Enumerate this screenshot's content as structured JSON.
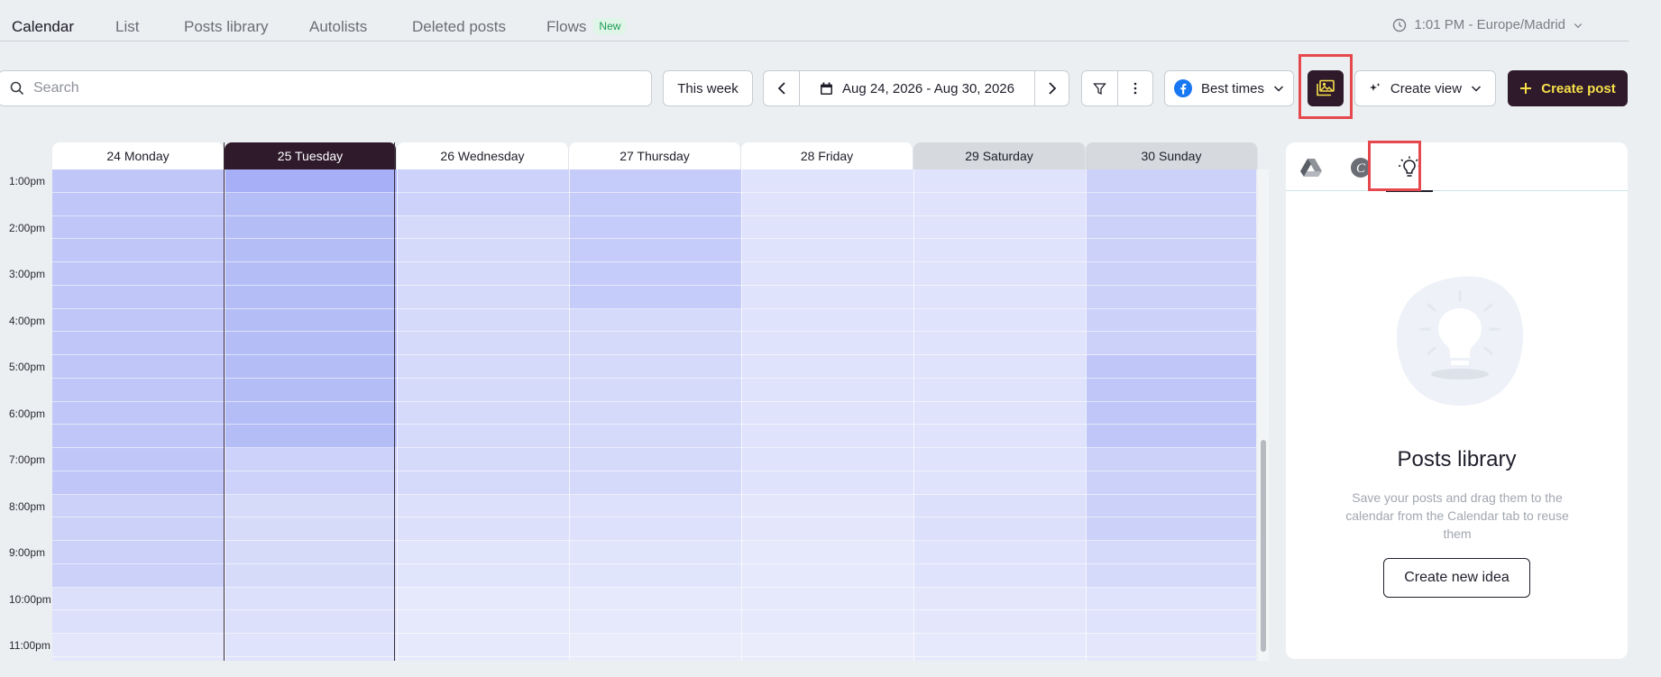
{
  "tabs": [
    {
      "label": "Calendar",
      "active": true
    },
    {
      "label": "List"
    },
    {
      "label": "Posts library"
    },
    {
      "label": "Autolists"
    },
    {
      "label": "Deleted posts"
    },
    {
      "label": "Flows",
      "badge": "New"
    }
  ],
  "timezone": {
    "label": "1:01 PM - Europe/Madrid",
    "icon": "clock-icon"
  },
  "toolbar": {
    "search_placeholder": "Search",
    "this_week": "This week",
    "date_range": "Aug 24, 2026 - Aug 30, 2026",
    "best_times": "Best times",
    "create_view": "Create view",
    "create_post": "Create post"
  },
  "calendar": {
    "days": [
      {
        "label": "24 Monday"
      },
      {
        "label": "25 Tuesday",
        "today": true
      },
      {
        "label": "26 Wednesday"
      },
      {
        "label": "27 Thursday"
      },
      {
        "label": "28 Friday"
      },
      {
        "label": "29 Saturday",
        "weekend": true
      },
      {
        "label": "30 Sunday",
        "weekend": true
      }
    ],
    "hours": [
      "1:00pm",
      "2:00pm",
      "3:00pm",
      "4:00pm",
      "5:00pm",
      "6:00pm",
      "7:00pm",
      "8:00pm",
      "9:00pm",
      "10:00pm",
      "11:00pm"
    ],
    "best_time_intensity": [
      [
        0.55,
        0.55,
        0.55,
        0.55,
        0.55,
        0.55,
        0.55,
        0.55,
        0.55,
        0.55,
        0.55,
        0.55,
        0.55,
        0.55,
        0.42,
        0.42,
        0.42,
        0.42,
        0.22,
        0.22,
        0.12,
        0.12
      ],
      [
        0.85,
        0.68,
        0.68,
        0.68,
        0.68,
        0.68,
        0.68,
        0.68,
        0.68,
        0.68,
        0.68,
        0.68,
        0.4,
        0.4,
        0.28,
        0.28,
        0.28,
        0.28,
        0.22,
        0.22,
        0.18,
        0.18
      ],
      [
        0.4,
        0.4,
        0.3,
        0.3,
        0.3,
        0.3,
        0.3,
        0.3,
        0.3,
        0.3,
        0.3,
        0.3,
        0.3,
        0.3,
        0.22,
        0.22,
        0.15,
        0.15,
        0.1,
        0.1,
        0.1,
        0.1
      ],
      [
        0.48,
        0.48,
        0.48,
        0.48,
        0.48,
        0.48,
        0.3,
        0.3,
        0.3,
        0.3,
        0.3,
        0.3,
        0.3,
        0.3,
        0.2,
        0.2,
        0.15,
        0.15,
        0.1,
        0.1,
        0.05,
        0.05
      ],
      [
        0.18,
        0.18,
        0.18,
        0.18,
        0.18,
        0.18,
        0.18,
        0.18,
        0.18,
        0.18,
        0.18,
        0.18,
        0.18,
        0.18,
        0.12,
        0.12,
        0.1,
        0.1,
        0.1,
        0.1,
        0.05,
        0.05
      ],
      [
        0.18,
        0.18,
        0.18,
        0.18,
        0.18,
        0.18,
        0.18,
        0.18,
        0.18,
        0.18,
        0.18,
        0.18,
        0.18,
        0.18,
        0.22,
        0.22,
        0.18,
        0.18,
        0.12,
        0.12,
        0.1,
        0.1
      ],
      [
        0.42,
        0.42,
        0.42,
        0.42,
        0.42,
        0.42,
        0.42,
        0.42,
        0.55,
        0.55,
        0.55,
        0.55,
        0.42,
        0.42,
        0.42,
        0.42,
        0.3,
        0.3,
        0.18,
        0.18,
        0.12,
        0.12
      ]
    ]
  },
  "panel": {
    "title": "Posts library",
    "description": "Save your posts and drag them to the calendar from the Calendar tab to reuse them",
    "button": "Create new idea",
    "tabs": [
      "google-drive-icon",
      "canva-icon",
      "lightbulb-icon"
    ]
  },
  "colors": {
    "brand_dark": "#2e1a2b",
    "accent_yellow": "#f7e04a",
    "highlight_red": "#e5484d",
    "best_time_blue": "#9aa5f5"
  }
}
